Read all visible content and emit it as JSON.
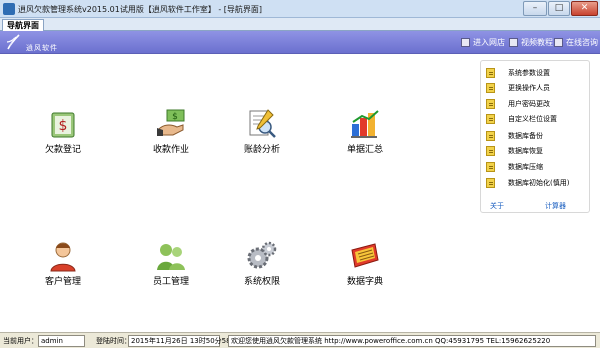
{
  "window": {
    "title": "逍风欠款管理系统v2015.01试用版【逍风软件工作室】 - [导航界面]"
  },
  "tabs": [
    {
      "label": "导航界面"
    }
  ],
  "banner": {
    "brand": "逍风软件",
    "links": [
      {
        "label": "进入网店"
      },
      {
        "label": "视频教程"
      },
      {
        "label": "在线咨询"
      }
    ]
  },
  "tiles": [
    {
      "label": "欠款登记",
      "icon": "money-register-icon"
    },
    {
      "label": "收款作业",
      "icon": "payment-collection-icon"
    },
    {
      "label": "账龄分析",
      "icon": "aging-analysis-icon"
    },
    {
      "label": "单据汇总",
      "icon": "bar-chart-icon"
    },
    {
      "label": "客户管理",
      "icon": "customer-icon"
    },
    {
      "label": "员工管理",
      "icon": "employees-icon"
    },
    {
      "label": "系统权限",
      "icon": "gears-icon"
    },
    {
      "label": "数据字典",
      "icon": "dictionary-icon"
    }
  ],
  "side_panel": {
    "items": [
      {
        "label": "系统参数设置"
      },
      {
        "label": "更换操作人员"
      },
      {
        "label": "用户密码更改"
      },
      {
        "label": "自定义栏位设置"
      },
      {
        "label": "数据库备份"
      },
      {
        "label": "数据库恢复"
      },
      {
        "label": "数据库压缩"
      },
      {
        "label": "数据库初始化(慎用)"
      }
    ],
    "about": "关于",
    "calculator": "计算器"
  },
  "status": {
    "user_label": "当前用户：",
    "user_value": "admin",
    "login_label": "登陆时间：",
    "login_value": "2015年11月26日 13时50分58秒",
    "message": "欢迎您使用逍风欠款管理系统 http://www.poweroffice.com.cn QQ:45931795 TEL:15962625220"
  },
  "colors": {
    "banner": "#7d81dd",
    "titlebar": "#cfe0f3",
    "link": "#1b5fc0"
  }
}
